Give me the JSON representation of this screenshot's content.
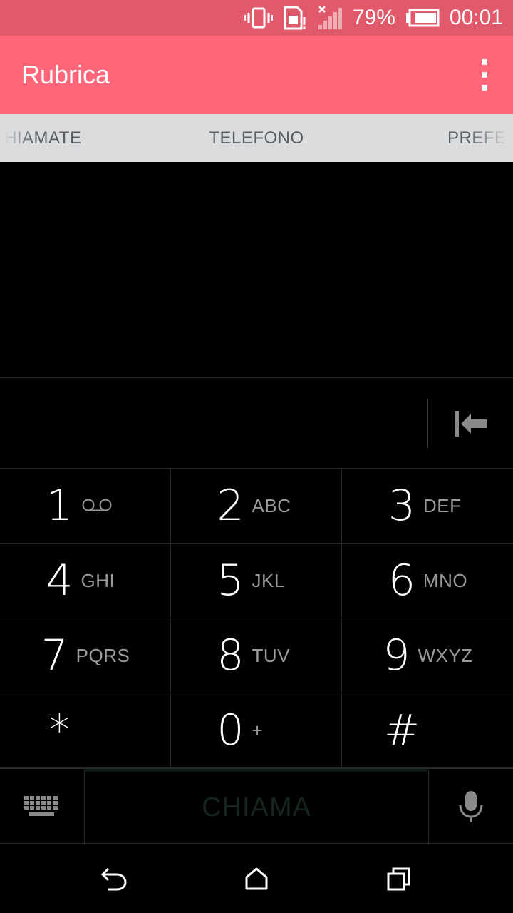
{
  "status_bar": {
    "battery_percent": "79%",
    "time": "00:01",
    "icons": [
      "vibrate-icon",
      "sim-alert-icon",
      "signal-no-service-icon",
      "battery-icon"
    ]
  },
  "app_bar": {
    "title": "Rubrica",
    "overflow_icon": "more-vertical-icon"
  },
  "tabs": {
    "items": [
      {
        "label": "HIAMATE",
        "selected": false
      },
      {
        "label": "TELEFONO",
        "selected": true
      },
      {
        "label": "PREFERI",
        "selected": false
      }
    ]
  },
  "dialer": {
    "number": "",
    "backspace_icon": "backspace-icon"
  },
  "keypad": {
    "keys": [
      {
        "digit": "1",
        "letters": "",
        "icon": "voicemail-icon"
      },
      {
        "digit": "2",
        "letters": "ABC"
      },
      {
        "digit": "3",
        "letters": "DEF"
      },
      {
        "digit": "4",
        "letters": "GHI"
      },
      {
        "digit": "5",
        "letters": "JKL"
      },
      {
        "digit": "6",
        "letters": "MNO"
      },
      {
        "digit": "7",
        "letters": "PQRS"
      },
      {
        "digit": "8",
        "letters": "TUV"
      },
      {
        "digit": "9",
        "letters": "WXYZ"
      },
      {
        "digit": "*",
        "letters": ""
      },
      {
        "digit": "0",
        "letters": "+"
      },
      {
        "digit": "#",
        "letters": ""
      }
    ]
  },
  "action_bar": {
    "keyboard_icon": "keyboard-icon",
    "call_label": "CHIAMA",
    "mic_icon": "microphone-icon"
  },
  "nav_bar": {
    "back_icon": "back-icon",
    "home_icon": "home-icon",
    "recents_icon": "recents-icon"
  },
  "colors": {
    "status_bar": "#e05a6c",
    "app_bar": "#ff667a",
    "tab_bar": "#dadcdd",
    "tab_text": "#5b5f63",
    "call_text_disabled": "#14261c"
  }
}
